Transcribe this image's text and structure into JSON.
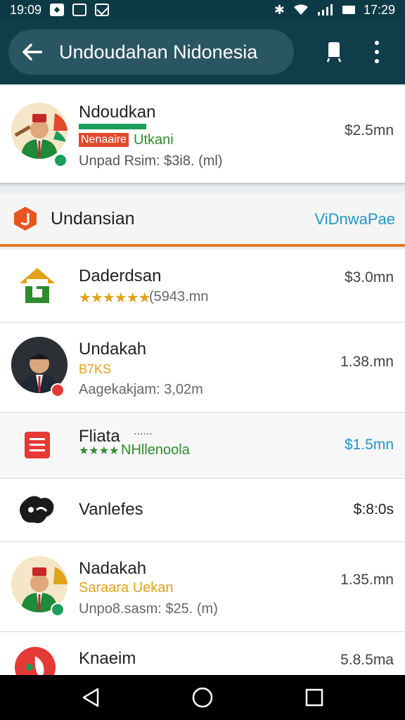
{
  "status_bar": {
    "time_left": "19:09",
    "time_right": "17:29"
  },
  "app_bar": {
    "search_text": "Undoudahan Nidonesia"
  },
  "featured": {
    "title": "Ndoudkan",
    "tag_red": "Nenaaire",
    "tag_green": "Utkani",
    "detail": "Unpad Rsim: $3i8. (ml)",
    "price": "$2.5mn"
  },
  "section": {
    "title": "Undansian",
    "link": "ViDnwaPae"
  },
  "rows": [
    {
      "title": "Daderdsan",
      "stars": "★★★★★★",
      "detail": "(5943.mn",
      "price": "$3.0mn"
    },
    {
      "title": "Undakah",
      "tag": "B7KS",
      "detail": "Aagekakjam: 3,02m",
      "price": "1.38.mn"
    },
    {
      "title": "Fliata",
      "title_suffix": "......",
      "stars": "★★★★",
      "tag": "NHllenoola",
      "price": "$1.5mn"
    },
    {
      "title": "Vanlefes",
      "price": "$:8:0s"
    },
    {
      "title": "Nadakah",
      "tag": "Saraara Uekan",
      "detail": "Unpo8.sasm: $25. (m)",
      "price": "1.35.mn"
    },
    {
      "title": "Knaeim",
      "price": "5.8.5ma"
    }
  ],
  "colors": {
    "appbar": "#0f3e4a",
    "accent_orange": "#e07a2a",
    "link_blue": "#1f97c6",
    "green": "#2e8b2e",
    "gold": "#e0a21a"
  }
}
